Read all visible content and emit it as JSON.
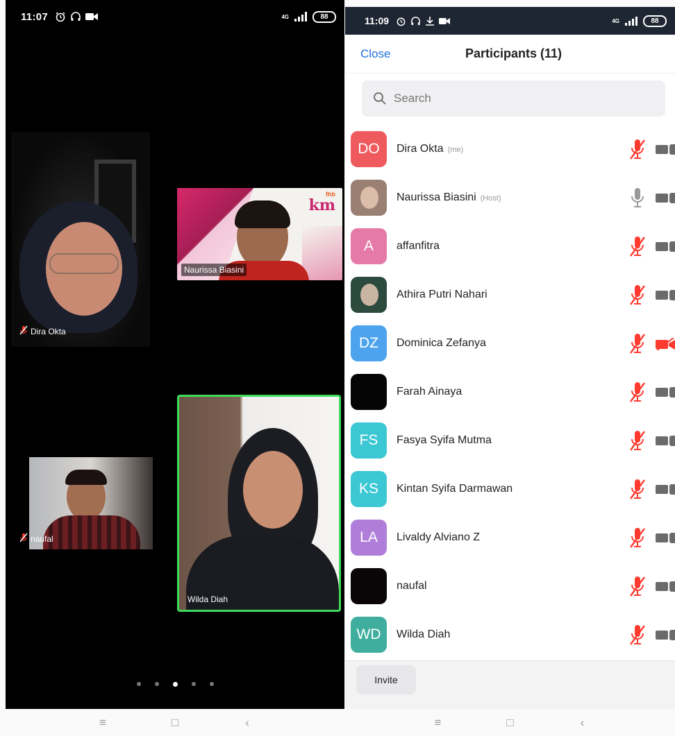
{
  "left_phone": {
    "status_bar": {
      "time": "11:07",
      "battery": "88",
      "network": "4G"
    },
    "tiles": [
      {
        "name": "Dira Okta",
        "muted": true
      },
      {
        "name": "Naurissa Biasini",
        "muted": false,
        "logo_text": "km",
        "logo_small": "fhb"
      },
      {
        "name": "naufal",
        "muted": true
      },
      {
        "name": "Wilda Diah",
        "muted": false,
        "active_speaker": true
      }
    ],
    "pager": {
      "pages": 5,
      "current": 3
    }
  },
  "right_phone": {
    "status_bar": {
      "time": "11:09",
      "battery": "88",
      "network": "4G"
    },
    "header": {
      "close_label": "Close",
      "title": "Participants (11)"
    },
    "search": {
      "placeholder": "Search"
    },
    "participants": [
      {
        "initials": "DO",
        "name": "Dira Okta",
        "tag": "(me)",
        "color": "#ef5a5e",
        "mic": "muted",
        "video": "off"
      },
      {
        "initials": "",
        "name": "Naurissa Biasini",
        "tag": "(Host)",
        "color": "#9a7f73",
        "mic": "on",
        "video": "off",
        "photo": true
      },
      {
        "initials": "A",
        "name": "affanfitra",
        "tag": "",
        "color": "#e57aa8",
        "mic": "muted",
        "video": "off"
      },
      {
        "initials": "",
        "name": "Athira Putri Nahari",
        "tag": "",
        "color": "#2c4a3e",
        "mic": "muted",
        "video": "off",
        "photo": true
      },
      {
        "initials": "DZ",
        "name": "Dominica Zefanya",
        "tag": "",
        "color": "#4da3ee",
        "mic": "muted",
        "video": "muted"
      },
      {
        "initials": "",
        "name": "Farah Ainaya",
        "tag": "",
        "color": "#050505",
        "mic": "muted",
        "video": "off"
      },
      {
        "initials": "FS",
        "name": "Fasya Syifa Mutma",
        "tag": "",
        "color": "#3bc7d3",
        "mic": "muted",
        "video": "off"
      },
      {
        "initials": "KS",
        "name": "Kintan Syifa Darmawan",
        "tag": "",
        "color": "#3bc7d3",
        "mic": "muted",
        "video": "off"
      },
      {
        "initials": "LA",
        "name": "Livaldy Alviano Z",
        "tag": "",
        "color": "#b07ed8",
        "mic": "muted",
        "video": "off"
      },
      {
        "initials": "",
        "name": "naufal",
        "tag": "",
        "color": "#0a0608",
        "mic": "muted",
        "video": "off"
      },
      {
        "initials": "WD",
        "name": "Wilda Diah",
        "tag": "",
        "color": "#3fae9e",
        "mic": "muted",
        "video": "off"
      }
    ],
    "footer": {
      "invite_label": "Invite"
    }
  },
  "nav_bar": {
    "menu_icon": "menu-icon",
    "home_icon": "home-icon",
    "back_icon": "back-icon"
  },
  "colors": {
    "accent": "#1e6fd9",
    "muted_red": "#ff3b30",
    "active_speaker_border": "#3ddc5a"
  }
}
